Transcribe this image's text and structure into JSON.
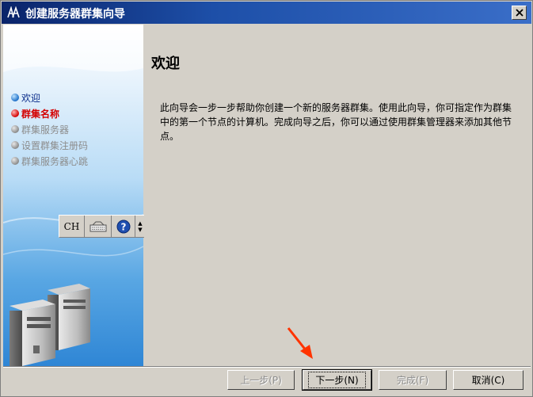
{
  "window": {
    "title": "创建服务器群集向导"
  },
  "sidebar": {
    "steps": [
      {
        "label": "欢迎",
        "state": "done"
      },
      {
        "label": "群集名称",
        "state": "current"
      },
      {
        "label": "群集服务器",
        "state": "todo"
      },
      {
        "label": "设置群集注册码",
        "state": "todo"
      },
      {
        "label": "群集服务器心跳",
        "state": "todo"
      }
    ]
  },
  "ime_bar": {
    "language": "CH"
  },
  "content": {
    "heading": "欢迎",
    "description": "此向导会一步一步帮助你创建一个新的服务器群集。使用此向导，你可指定作为群集中的第一个节点的计算机。完成向导之后，你可以通过使用群集管理器来添加其他节点。"
  },
  "buttons": {
    "back": "上一步(P)",
    "next": "下一步(N)",
    "finish": "完成(F)",
    "cancel": "取消(C)"
  },
  "colors": {
    "title_bar": "#0a246a",
    "current_step": "#d40000",
    "done_step": "#0a2c8a",
    "annotation_arrow": "#ff3300"
  }
}
